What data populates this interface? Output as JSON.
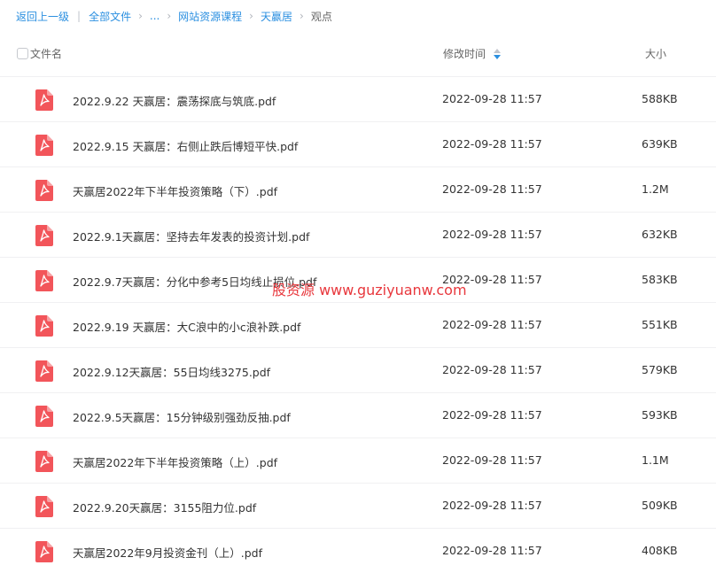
{
  "breadcrumb": {
    "back": "返回上一级",
    "sep_bar": "|",
    "all_files": "全部文件",
    "ellipsis": "...",
    "folder1": "网站资源课程",
    "folder2": "天赢居",
    "current": "观点",
    "chevron": "›"
  },
  "table_header": {
    "name": "文件名",
    "time": "修改时间",
    "size": "大小"
  },
  "files": [
    {
      "name": "2022.9.22 天赢居：震荡探底与筑底.pdf",
      "time": "2022-09-28 11:57",
      "size": "588KB"
    },
    {
      "name": "2022.9.15 天赢居：右侧止跌后博短平快.pdf",
      "time": "2022-09-28 11:57",
      "size": "639KB"
    },
    {
      "name": "天赢居2022年下半年投资策略（下）.pdf",
      "time": "2022-09-28 11:57",
      "size": "1.2M"
    },
    {
      "name": "2022.9.1天赢居：坚持去年发表的投资计划.pdf",
      "time": "2022-09-28 11:57",
      "size": "632KB"
    },
    {
      "name": "2022.9.7天赢居：分化中参考5日均线止损位.pdf",
      "time": "2022-09-28 11:57",
      "size": "583KB"
    },
    {
      "name": "2022.9.19 天赢居：大C浪中的小c浪补跌.pdf",
      "time": "2022-09-28 11:57",
      "size": "551KB"
    },
    {
      "name": "2022.9.12天赢居：55日均线3275.pdf",
      "time": "2022-09-28 11:57",
      "size": "579KB"
    },
    {
      "name": "2022.9.5天赢居：15分钟级别强劲反抽.pdf",
      "time": "2022-09-28 11:57",
      "size": "593KB"
    },
    {
      "name": "天赢居2022年下半年投资策略（上）.pdf",
      "time": "2022-09-28 11:57",
      "size": "1.1M"
    },
    {
      "name": "2022.9.20天赢居：3155阻力位.pdf",
      "time": "2022-09-28 11:57",
      "size": "509KB"
    },
    {
      "name": "天赢居2022年9月投资金刊（上）.pdf",
      "time": "2022-09-28 11:57",
      "size": "408KB"
    }
  ],
  "watermark": "股资源 www.guziyuanw.com",
  "colors": {
    "link": "#2b8fe0",
    "pdf_icon": "#f2555a",
    "sort_up": "#c0c4cc",
    "sort_down": "#2b8fe0",
    "watermark": "#e8383d"
  }
}
